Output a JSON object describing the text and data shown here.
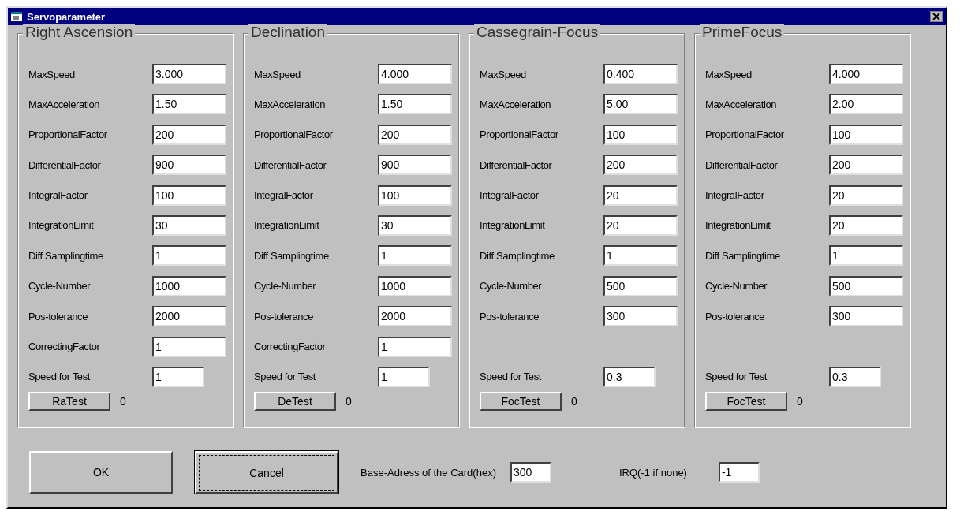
{
  "window": {
    "title": "Servoparameter"
  },
  "groups": [
    {
      "title": "Right Ascension",
      "params": [
        {
          "label": "MaxSpeed",
          "value": "3.000"
        },
        {
          "label": "MaxAcceleration",
          "value": "1.50"
        },
        {
          "label": "ProportionalFactor",
          "value": "200"
        },
        {
          "label": "DifferentialFactor",
          "value": "900"
        },
        {
          "label": "IntegralFactor",
          "value": "100"
        },
        {
          "label": "IntegrationLimit",
          "value": "30"
        },
        {
          "label": "Diff Samplingtime",
          "value": "1"
        },
        {
          "label": "Cycle-Number",
          "value": "1000"
        },
        {
          "label": "Pos-tolerance",
          "value": "2000"
        },
        {
          "label": "CorrectingFactor",
          "value": "1"
        }
      ],
      "speed_label": "Speed for Test",
      "speed_value": "1",
      "test_button": "RaTest",
      "test_result": "0"
    },
    {
      "title": "Declination",
      "params": [
        {
          "label": "MaxSpeed",
          "value": "4.000"
        },
        {
          "label": "MaxAcceleration",
          "value": "1.50"
        },
        {
          "label": "ProportionalFactor",
          "value": "200"
        },
        {
          "label": "DifferentialFactor",
          "value": "900"
        },
        {
          "label": "IntegralFactor",
          "value": "100"
        },
        {
          "label": "IntegrationLimit",
          "value": "30"
        },
        {
          "label": "Diff Samplingtime",
          "value": "1"
        },
        {
          "label": "Cycle-Number",
          "value": "1000"
        },
        {
          "label": "Pos-tolerance",
          "value": "2000"
        },
        {
          "label": "CorrectingFactor",
          "value": "1"
        }
      ],
      "speed_label": "Speed for Test",
      "speed_value": "1",
      "test_button": "DeTest",
      "test_result": "0"
    },
    {
      "title": "Cassegrain-Focus",
      "params": [
        {
          "label": "MaxSpeed",
          "value": "0.400"
        },
        {
          "label": "MaxAcceleration",
          "value": "5.00"
        },
        {
          "label": "ProportionalFactor",
          "value": "100"
        },
        {
          "label": "DifferentialFactor",
          "value": "200"
        },
        {
          "label": "IntegralFactor",
          "value": "20"
        },
        {
          "label": "IntegrationLimit",
          "value": "20"
        },
        {
          "label": "Diff Samplingtime",
          "value": "1"
        },
        {
          "label": "Cycle-Number",
          "value": "500"
        },
        {
          "label": "Pos-tolerance",
          "value": "300"
        }
      ],
      "speed_label": "Speed for Test",
      "speed_value": "0.3",
      "test_button": "FocTest",
      "test_result": "0"
    },
    {
      "title": "PrimeFocus",
      "params": [
        {
          "label": "MaxSpeed",
          "value": "4.000"
        },
        {
          "label": "MaxAcceleration",
          "value": "2.00"
        },
        {
          "label": "ProportionalFactor",
          "value": "100"
        },
        {
          "label": "DifferentialFactor",
          "value": "200"
        },
        {
          "label": "IntegralFactor",
          "value": "20"
        },
        {
          "label": "IntegrationLimit",
          "value": "20"
        },
        {
          "label": "Diff Samplingtime",
          "value": "1"
        },
        {
          "label": "Cycle-Number",
          "value": "500"
        },
        {
          "label": "Pos-tolerance",
          "value": "300"
        }
      ],
      "speed_label": "Speed for Test",
      "speed_value": "0.3",
      "test_button": "FocTest",
      "test_result": "0"
    }
  ],
  "buttons": [
    {
      "label": "OK",
      "focused": false
    },
    {
      "label": "Cancel",
      "focused": true
    }
  ],
  "base_address": {
    "label": "Base-Adress of the Card(hex)",
    "value": "300"
  },
  "irq": {
    "label": "IRQ(-1 if none)",
    "value": "-1"
  }
}
